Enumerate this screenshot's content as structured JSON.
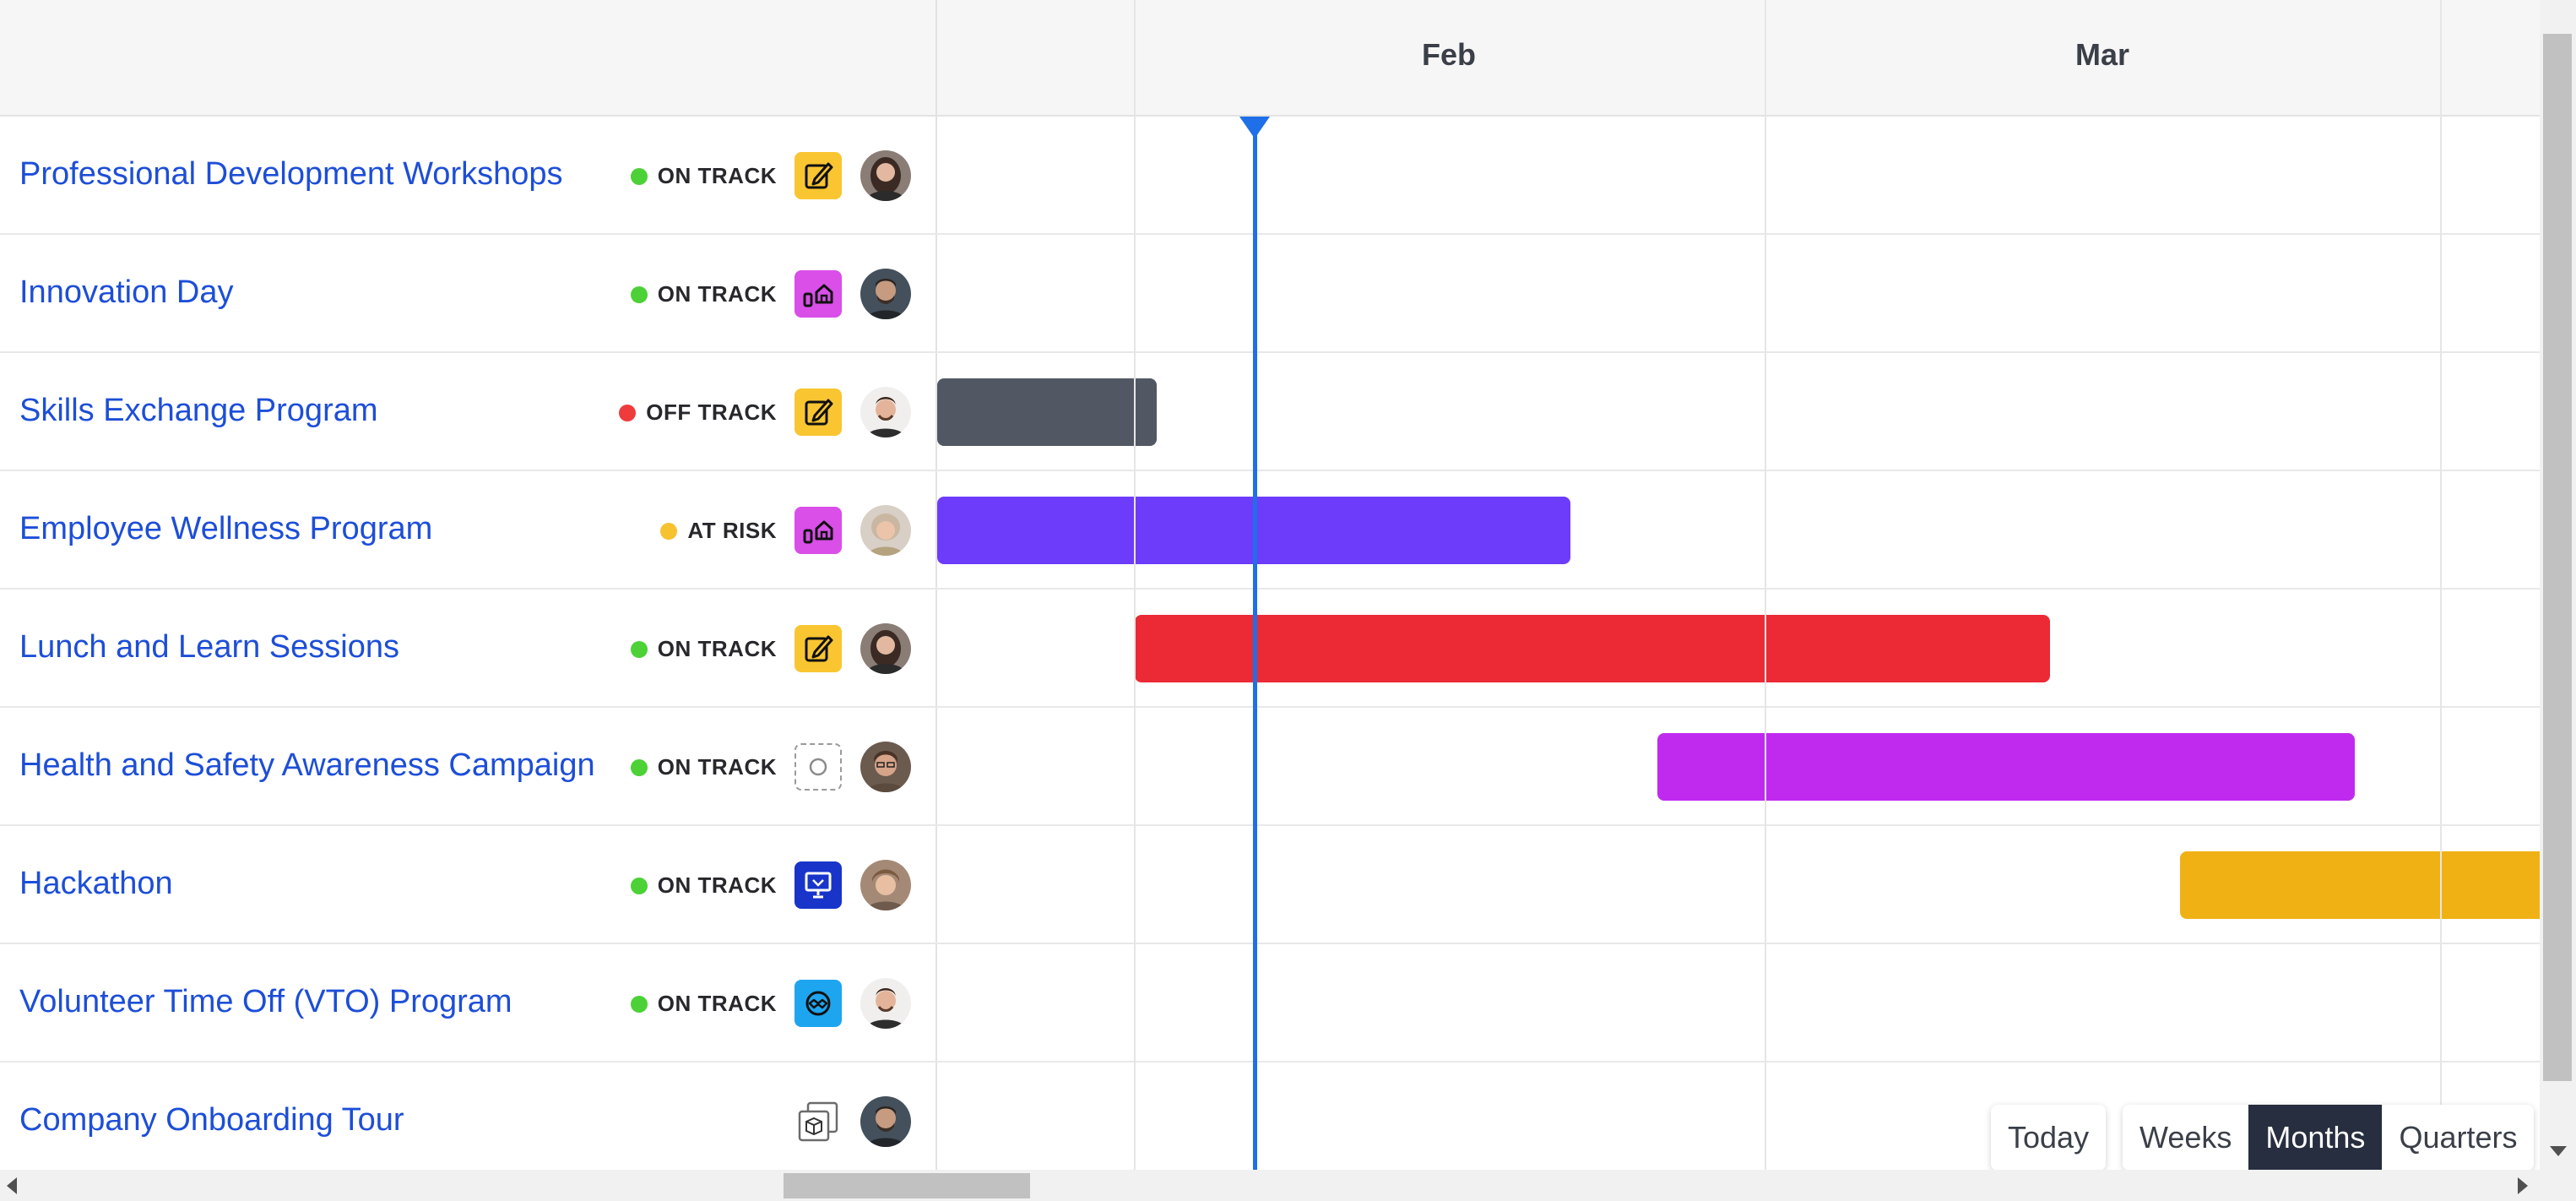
{
  "timeline": {
    "months": [
      "Feb",
      "Mar"
    ]
  },
  "rows": [
    {
      "title": "Professional Development Workshops",
      "status": "ON TRACK",
      "status_color": "#4cd137",
      "category_icon": "pencil-edit-icon",
      "category_color": "#f9c531"
    },
    {
      "title": "Innovation Day",
      "status": "ON TRACK",
      "status_color": "#4cd137",
      "category_icon": "house-bottle-icon",
      "category_color": "#d94fe8"
    },
    {
      "title": "Skills Exchange Program",
      "status": "OFF TRACK",
      "status_color": "#ef3b3b",
      "category_icon": "pencil-edit-icon",
      "category_color": "#f9c531",
      "bar_color": "#525863"
    },
    {
      "title": "Employee Wellness Program",
      "status": "AT RISK",
      "status_color": "#f6c230",
      "category_icon": "house-bottle-icon",
      "category_color": "#d94fe8",
      "bar_color": "#6d3cfb"
    },
    {
      "title": "Lunch and Learn Sessions",
      "status": "ON TRACK",
      "status_color": "#4cd137",
      "category_icon": "pencil-edit-icon",
      "category_color": "#f9c531",
      "bar_color": "#eb2a35"
    },
    {
      "title": "Health and Safety Awareness Campaign",
      "status": "ON TRACK",
      "status_color": "#4cd137",
      "category_icon": "empty-circle-icon",
      "category_color": "#ffffff",
      "bar_color": "#c02aee"
    },
    {
      "title": "Hackathon",
      "status": "ON TRACK",
      "status_color": "#4cd137",
      "category_icon": "presentation-board-icon",
      "category_color": "#1834c9",
      "bar_color": "#f0b114"
    },
    {
      "title": "Volunteer Time Off (VTO) Program",
      "status": "ON TRACK",
      "status_color": "#4cd137",
      "category_icon": "handshake-icon",
      "category_color": "#1ea5f0"
    },
    {
      "title": "Company Onboarding Tour",
      "status": "",
      "status_color": "",
      "category_icon": "stacked-boxes-icon",
      "category_color": "#ffffff"
    }
  ],
  "controls": {
    "today": "Today",
    "weeks": "Weeks",
    "months": "Months",
    "quarters": "Quarters",
    "active": "Months"
  }
}
